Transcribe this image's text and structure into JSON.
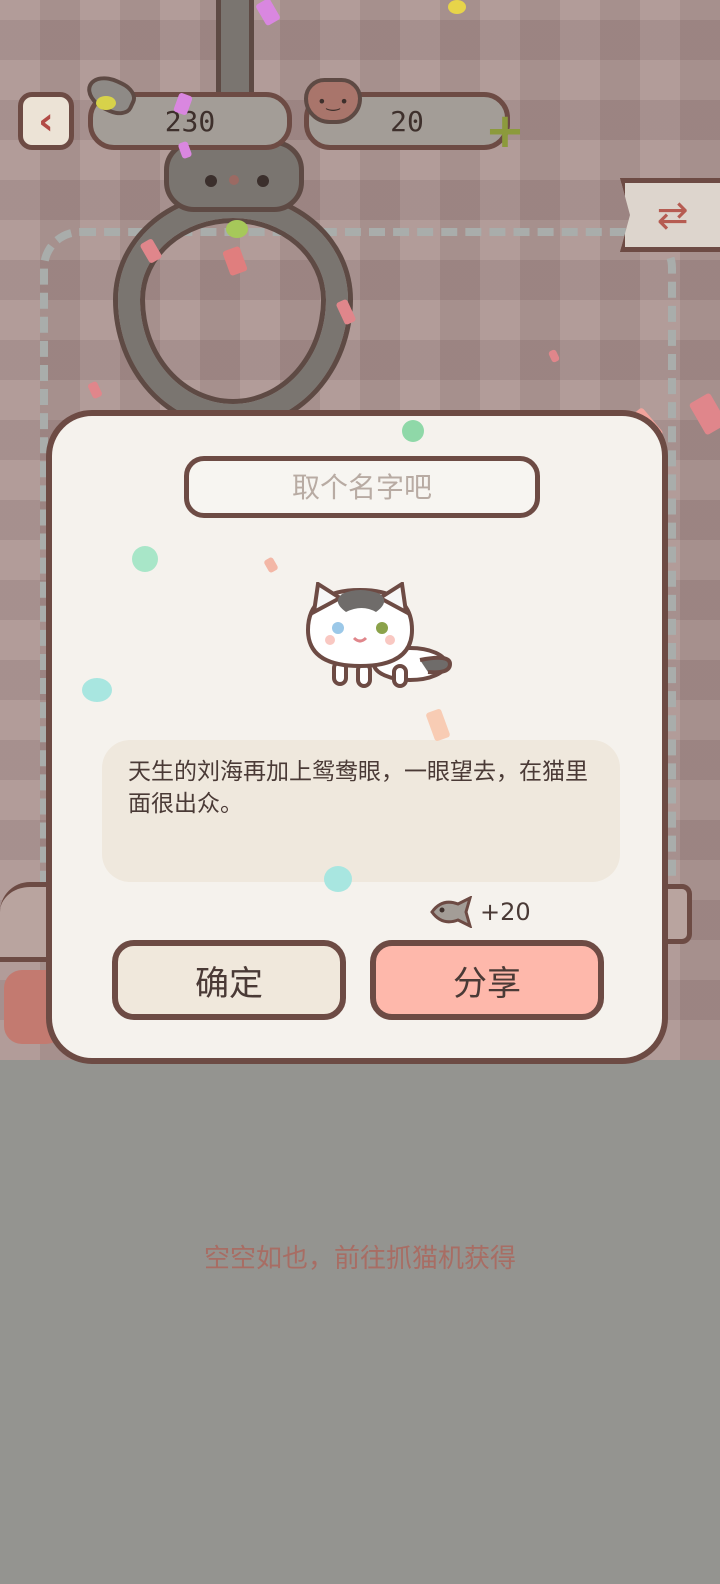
{
  "topbar": {
    "fish_count": "230",
    "heart_count": "20"
  },
  "modal": {
    "name_placeholder": "取个名字吧",
    "description": "天生的刘海再加上鸳鸯眼，一眼望去，在猫里面很出众。",
    "reward": "+20",
    "confirm_label": "确定",
    "share_label": "分享"
  },
  "empty_message": "空空如也，前往抓猫机获得",
  "colors": {
    "border": "#6d4b44",
    "share": "#feb8ab",
    "confirm": "#f0e8dc",
    "accent_green": "#8c9a3c"
  },
  "icons": [
    "back-arrow-icon",
    "fish-icon",
    "heart-icon",
    "plus-icon",
    "refresh-icon",
    "cat-icon"
  ]
}
